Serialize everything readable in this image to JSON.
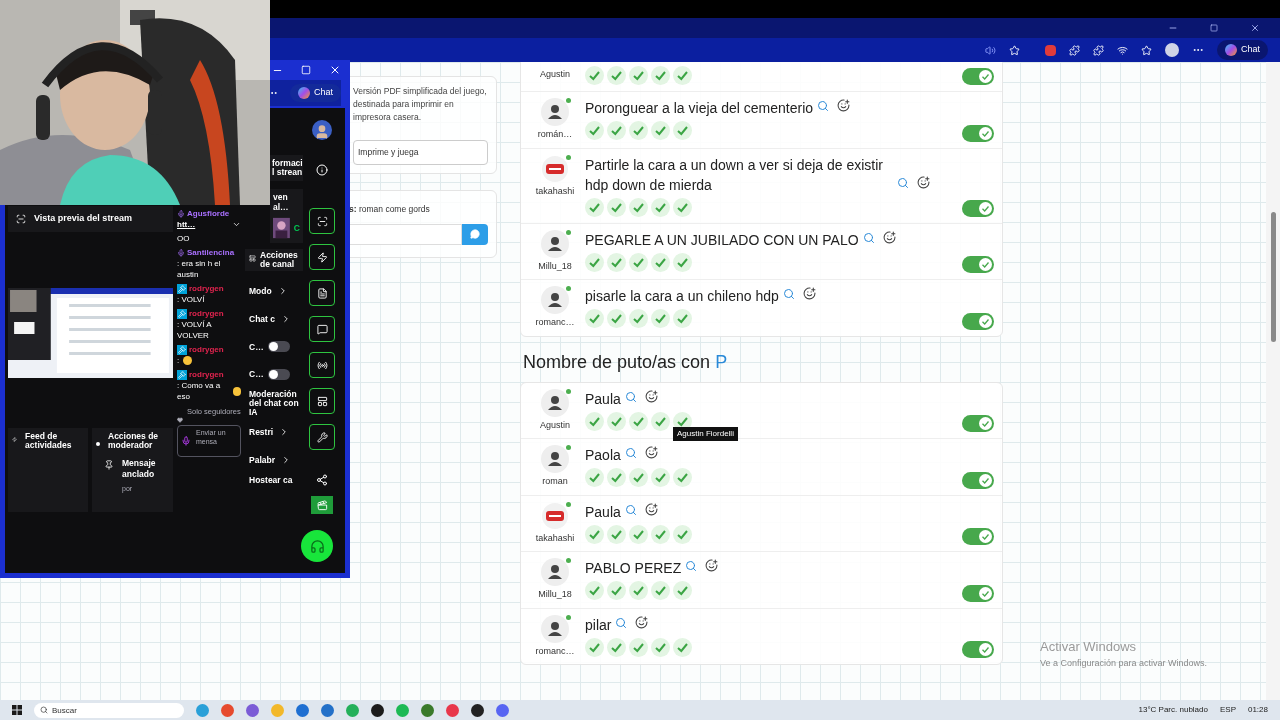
{
  "browser": {
    "chat_button": "Chat"
  },
  "left_panel": {
    "description": "Versión PDF simplificada del juego, destinada para imprimir en impresora casera.",
    "print_button": "Imprime y juega",
    "chat_prefix": "s:",
    "chat_message": "roman come gords"
  },
  "first_card": [
    {
      "user": "Agustin",
      "votes": [
        true,
        true,
        true,
        true,
        true
      ],
      "accepted": true
    },
    {
      "user": "román…",
      "kind": "person",
      "text": "Poronguear a la vieja del cementerio",
      "votes": [
        true,
        true,
        true,
        true,
        true
      ],
      "accepted": true
    },
    {
      "user": "takahashi",
      "kind": "stop",
      "text": "Partirle la cara a un down a ver si deja de existir hdp down de mierda",
      "votes": [
        true,
        true,
        true,
        true,
        true
      ],
      "accepted": true
    },
    {
      "user": "Millu_18",
      "kind": "person",
      "text": "PEGARLE A UN JUBILADO CON UN PALO",
      "votes": [
        true,
        true,
        true,
        true,
        true
      ],
      "accepted": true
    },
    {
      "user": "romanc…",
      "kind": "person",
      "text": "pisarle la cara a un chileno hdp",
      "votes": [
        true,
        true,
        true,
        true,
        true
      ],
      "accepted": true
    }
  ],
  "category": {
    "title": "Nombre de puto/as con",
    "letter": "P"
  },
  "second_card": [
    {
      "user": "Agustin",
      "kind": "person",
      "text": "Paula",
      "votes": [
        true,
        true,
        true,
        true,
        true
      ],
      "accepted": true,
      "tooltip": "Agustin Fiordelli"
    },
    {
      "user": "roman",
      "kind": "person",
      "text": "Paola",
      "votes": [
        true,
        true,
        true,
        true,
        true
      ],
      "accepted": true
    },
    {
      "user": "takahashi",
      "kind": "stop",
      "text": "Paula",
      "votes": [
        true,
        true,
        true,
        true,
        true
      ],
      "accepted": true
    },
    {
      "user": "Millu_18",
      "kind": "person",
      "text": "PABLO PEREZ",
      "votes": [
        true,
        true,
        true,
        true,
        true
      ],
      "accepted": true
    },
    {
      "user": "romanc…",
      "kind": "person",
      "text": "pilar",
      "votes": [
        true,
        true,
        true,
        true,
        true
      ],
      "accepted": true
    }
  ],
  "stream_window": {
    "chat_button": "Chat",
    "preview_title": "Vista previa del stream",
    "feed_title": "Feed de actividades",
    "mod_actions_title": "Acciones de moderador",
    "pinned_title": "Mensaje anclado",
    "pinned_by": "por",
    "chat": [
      {
        "user": "Agusfiorde",
        "color": "#a970ff",
        "text": "htt…",
        "expandable": true
      },
      {
        "text": "OO"
      },
      {
        "user": "Santilencina",
        "color": "#a970ff",
        "text": ": era sin h el austin"
      },
      {
        "user": "rodrygen",
        "color": "#e0234e",
        "text": ": VOLVÍ",
        "mod": true
      },
      {
        "user": "rodrygen",
        "color": "#e0234e",
        "text": ": VOLVÍ A VOLVER",
        "mod": true
      },
      {
        "user": "rodrygen",
        "color": "#e0234e",
        "text": ":",
        "mod": true,
        "emoji": true
      },
      {
        "user": "rodrygen",
        "color": "#e0234e",
        "text": ": Como va a eso",
        "mod": true,
        "emoji": true
      }
    ],
    "followers_only": "Solo seguidores",
    "message_placeholder": "Enviar un mensa",
    "info_card": [
      "formaci",
      "l strean"
    ],
    "host_card": "ven al…",
    "host_letter": "C",
    "channel_actions_title": "Acciones de canal",
    "actions": [
      {
        "kind": "link",
        "label": "Modo"
      },
      {
        "kind": "link",
        "label": "Chat c"
      },
      {
        "kind": "toggle",
        "label": "C…",
        "on": false
      },
      {
        "kind": "toggle",
        "label": "C…",
        "on": false
      },
      {
        "kind": "text",
        "label": "Moderación del chat con IA"
      },
      {
        "kind": "link",
        "label": "Restri"
      },
      {
        "kind": "link",
        "label": "Palabr"
      },
      {
        "kind": "text",
        "label": "Hostear ca"
      }
    ]
  },
  "activation": {
    "title": "Activar Windows",
    "subtitle": "Ve a Configuración para activar Windows."
  },
  "taskbar": {
    "search_placeholder": "Buscar",
    "weather": "13°C Parc. nublado",
    "language": "ESP",
    "time": "01:28"
  }
}
